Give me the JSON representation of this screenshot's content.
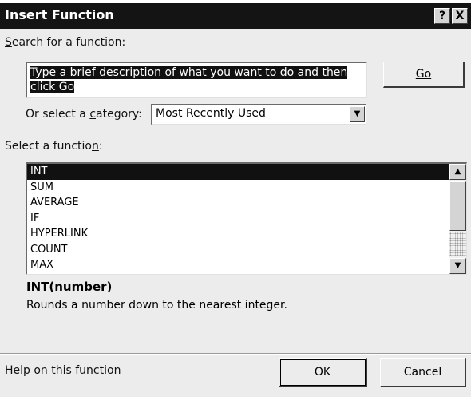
{
  "window": {
    "title": "Insert Function",
    "help_button": "?",
    "close_button": "X"
  },
  "search": {
    "label": "Search for a function:",
    "label_mnemonic": "S",
    "label_rest": "earch for a function:",
    "value": "Type a brief description of what you want to do and then click Go",
    "go_button": "Go"
  },
  "category": {
    "label_before": "Or select a ",
    "label_mnemonic": "c",
    "label_after": "ategory:",
    "selected": "Most Recently Used"
  },
  "functions": {
    "label_before": "Select a functio",
    "label_mnemonic": "n",
    "label_after": ":",
    "items": [
      "INT",
      "SUM",
      "AVERAGE",
      "IF",
      "HYPERLINK",
      "COUNT",
      "MAX"
    ],
    "selected_index": 0
  },
  "details": {
    "signature": "INT(number)",
    "description": "Rounds a number down to the nearest integer."
  },
  "footer": {
    "help_link": "Help on this function",
    "ok_button": "OK",
    "cancel_button": "Cancel"
  },
  "icons": {
    "dropdown_arrow": "chevron-down-icon",
    "scroll_up": "scroll-up-arrow-icon",
    "scroll_down": "scroll-down-arrow-icon"
  },
  "colors": {
    "titlebar": "#141414",
    "dialog_bg": "#ececec",
    "selection": "#111111"
  }
}
